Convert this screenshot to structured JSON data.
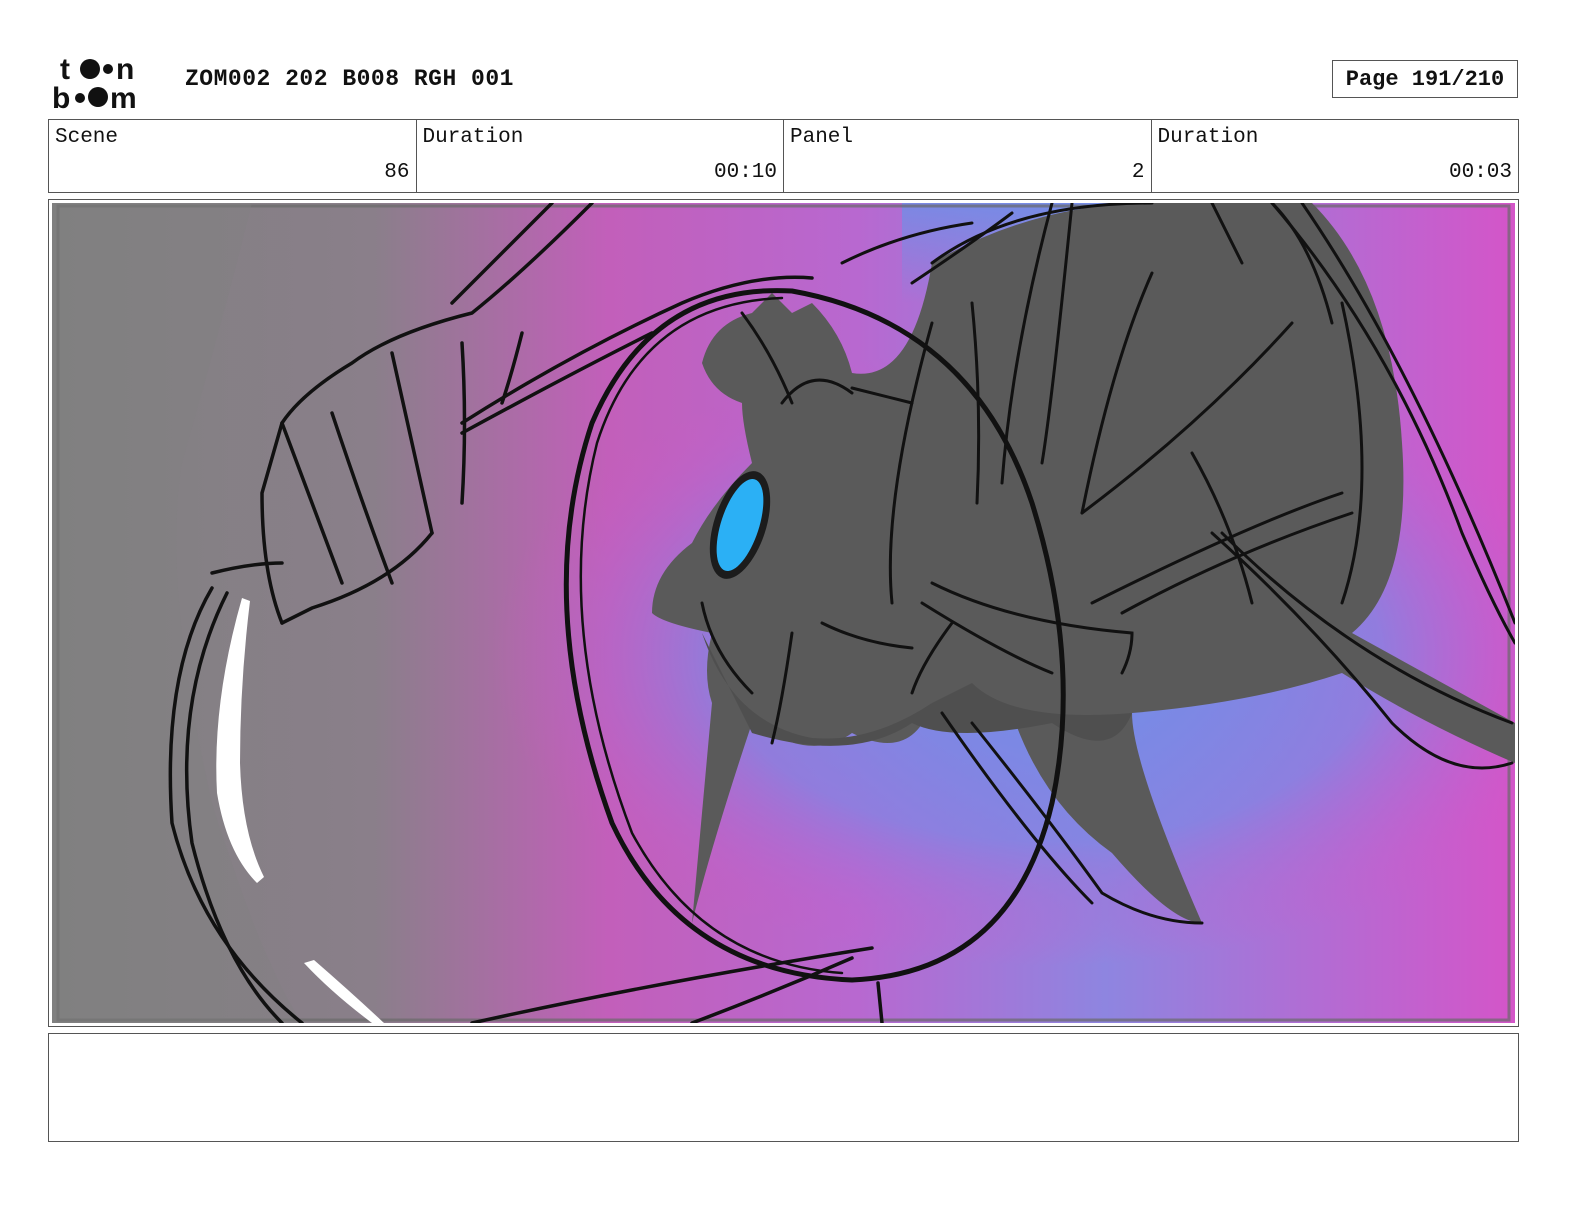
{
  "header": {
    "brand": "toon boom",
    "project_code": "ZOM002 202 B008 RGH 001",
    "page_label": "Page 191/210"
  },
  "info": [
    {
      "label": "Scene",
      "value": "86"
    },
    {
      "label": "Duration",
      "value": "00:10"
    },
    {
      "label": "Panel",
      "value": "2"
    },
    {
      "label": "Duration",
      "value": "00:03"
    }
  ],
  "panel": {
    "colors": {
      "gray": "#808080",
      "magenta": "#d455c8",
      "blue": "#6e8fe8",
      "character": "#5a5a5a",
      "eye": "#2bb0f5"
    }
  },
  "notes": {
    "text": ""
  }
}
